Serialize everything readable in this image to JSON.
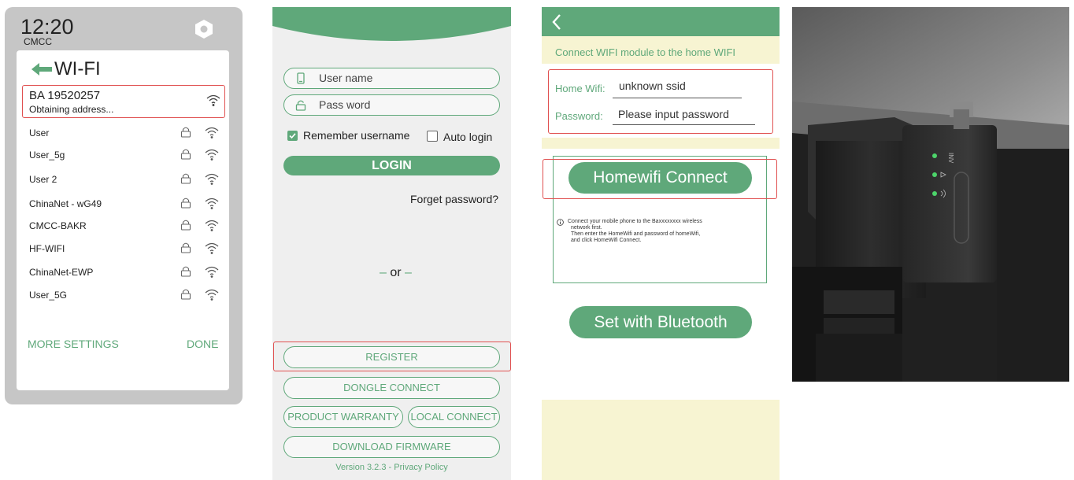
{
  "wifi_panel": {
    "time": "12:20",
    "carrier": "CMCC",
    "title": "WI-FI",
    "selected_network": {
      "name": "BA 19520257",
      "status": "Obtaining address..."
    },
    "networks": [
      {
        "name": "User",
        "locked": true
      },
      {
        "name": "User_5g",
        "locked": true
      },
      {
        "name": "User 2",
        "locked": true
      },
      {
        "name": "ChinaNet - wG49",
        "locked": true
      },
      {
        "name": "CMCC-BAKR",
        "locked": true
      },
      {
        "name": "HF-WIFI",
        "locked": true
      },
      {
        "name": "ChinaNet-EWP",
        "locked": true
      },
      {
        "name": "User_5G",
        "locked": true
      }
    ],
    "more_settings": "MORE SETTINGS",
    "done": "DONE",
    "icons": {
      "back": "back-arrow-icon",
      "corner": "hexagon-icon",
      "lock": "lock-icon",
      "signal": "wifi-signal-icon"
    }
  },
  "login_panel": {
    "username_placeholder": "User name",
    "password_placeholder": "Pass word",
    "remember_label": "Remember username",
    "remember_checked": true,
    "auto_login_label": "Auto login",
    "auto_login_checked": false,
    "login_button": "LOGIN",
    "forget_password": "Forget password?",
    "or_text": "or",
    "register": "REGISTER",
    "dongle_connect": "DONGLE CONNECT",
    "product_warranty": "PRODUCT WARRANTY",
    "local_connect": "LOCAL CONNECT",
    "download_firmware": "DOWNLOAD FIRMWARE",
    "version": "Version 3.2.3 - Privacy Policy"
  },
  "connect_panel": {
    "banner": "Connect WIFI module to the home WIFI",
    "home_wifi_label": "Home Wifi:",
    "home_wifi_value": "unknown ssid",
    "password_label": "Password:",
    "password_placeholder": "Please input password",
    "homewifi_connect": "Homewifi Connect",
    "note_line1": "Connect your mobile phone to the Baxxxxxxxx wireless",
    "note_line2": "network first.",
    "note_line3": "Then enter the HomeWifi and password of  homeWifi,",
    "note_line4": "and click HomeWifi Connect.",
    "set_bluetooth": "Set with Bluetooth"
  },
  "device_photo": {
    "labels": [
      "INV"
    ]
  },
  "colors": {
    "accent": "#5fa87a",
    "highlight_red": "#e05050",
    "cream": "#f7f4d2",
    "panel_gray": "#c6c6c6"
  }
}
